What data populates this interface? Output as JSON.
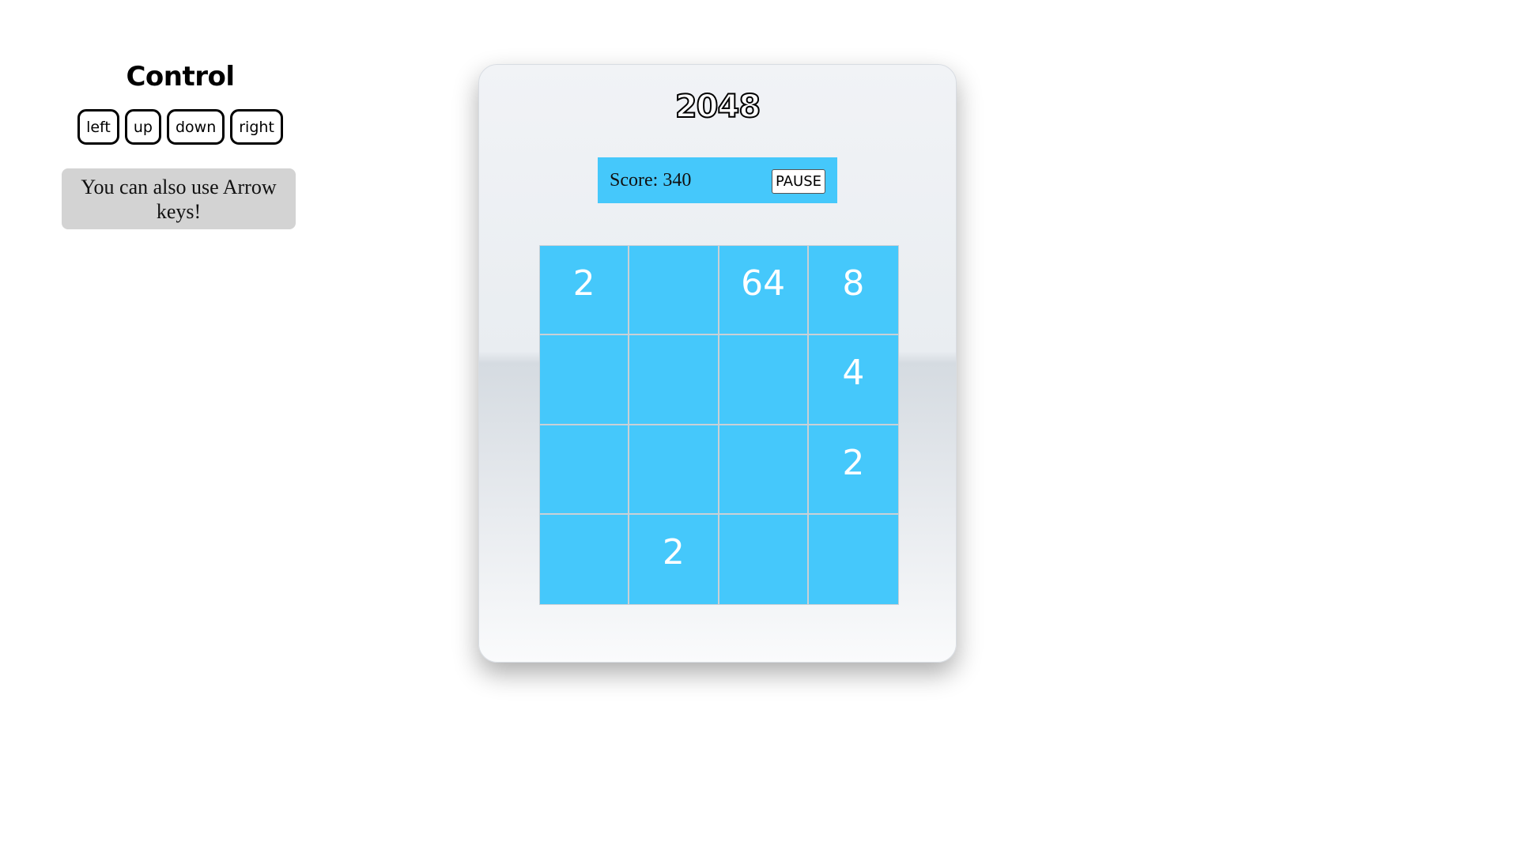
{
  "control": {
    "title": "Control",
    "buttons": {
      "left": "left",
      "up": "up",
      "down": "down",
      "right": "right"
    },
    "hint": "You can also use Arrow keys!"
  },
  "game": {
    "title": "2048",
    "score_text": "Score: 340",
    "pause_label": "PAUSE",
    "board": [
      [
        "2",
        "",
        "64",
        "8"
      ],
      [
        "",
        "",
        "",
        "4"
      ],
      [
        "",
        "",
        "",
        "2"
      ],
      [
        "",
        "2",
        "",
        ""
      ]
    ]
  },
  "colors": {
    "tile_blue": "#45c8fb",
    "hint_gray": "#d3d3d3"
  }
}
